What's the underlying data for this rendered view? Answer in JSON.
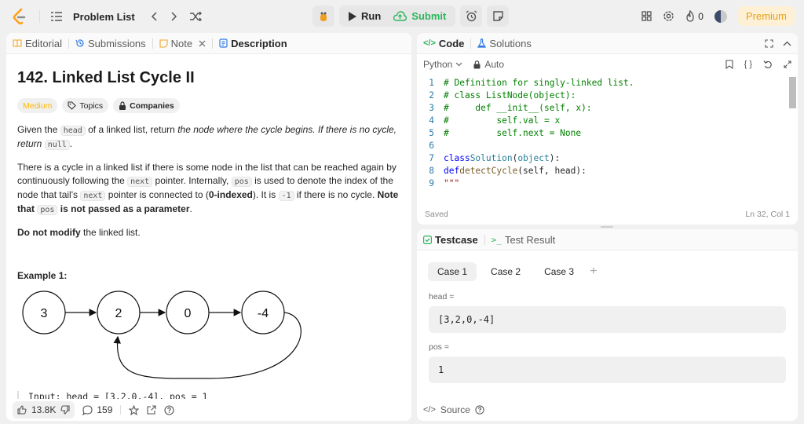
{
  "topbar": {
    "problem_list_label": "Problem List",
    "run_label": "Run",
    "submit_label": "Submit",
    "fire_count": "0",
    "premium_label": "Premium"
  },
  "left_tabs": [
    {
      "label": "Editorial"
    },
    {
      "label": "Submissions"
    },
    {
      "label": "Note"
    },
    {
      "label": "Description"
    }
  ],
  "problem": {
    "title": "142. Linked List Cycle II",
    "difficulty": "Medium",
    "topics_label": "Topics",
    "companies_label": "Companies",
    "p1": {
      "a": "Given the ",
      "code_head": "head",
      "b": " of a linked list, return ",
      "italic": "the node where the cycle begins. If there is no cycle, return ",
      "code_null": "null",
      "c": "."
    },
    "p2": {
      "a": "There is a cycle in a linked list if there is some node in the list that can be reached again by continuously following the ",
      "code_next": "next",
      "b": " pointer. Internally, ",
      "code_pos": "pos",
      "c": " is used to denote the index of the node that tail's ",
      "code_next2": "next",
      "d": " pointer is connected to (",
      "bold_idx": "0-indexed",
      "e": "). It is ",
      "code_neg": "-1",
      "f": " if there is no cycle. ",
      "bold_note": "Note that ",
      "code_pos2": "pos",
      "bold_note2": " is not passed as a parameter",
      "g": "."
    },
    "p3": {
      "bold": "Do not modify",
      "rest": " the linked list."
    },
    "example_title": "Example 1:",
    "nodes": [
      "3",
      "2",
      "0",
      "-4"
    ],
    "input_line": "Input: head = [3,2,0,-4], pos = 1"
  },
  "bottom": {
    "likes": "13.8K",
    "comments": "159"
  },
  "code_panel": {
    "tab_code": "Code",
    "tab_solutions": "Solutions",
    "language": "Python",
    "auto_label": "Auto",
    "status_saved": "Saved",
    "cursor_pos": "Ln 32, Col 1",
    "line_numbers": [
      "1",
      "2",
      "3",
      "4",
      "5",
      "6",
      "7",
      "8",
      "9"
    ]
  },
  "test_panel": {
    "tab_testcase": "Testcase",
    "tab_result": "Test Result",
    "cases": [
      "Case 1",
      "Case 2",
      "Case 3"
    ],
    "head_label": "head =",
    "head_value": "[3,2,0,-4]",
    "pos_label": "pos =",
    "pos_value": "1",
    "source_label": "Source"
  },
  "colors": {
    "accent_green": "#2db55d",
    "medium_yellow": "#ffb800",
    "premium_orange": "#e6a11a"
  }
}
